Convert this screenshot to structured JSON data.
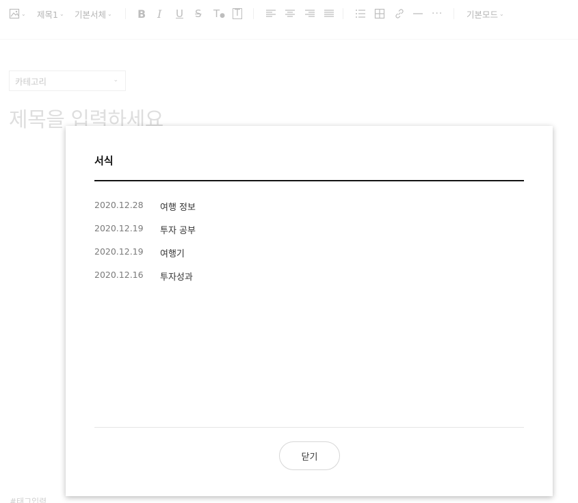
{
  "toolbar": {
    "image_icon": "image-icon",
    "heading_label": "제목1",
    "font_label": "기본서체",
    "bold_glyph": "B",
    "italic_glyph": "I",
    "underline_glyph": "U",
    "strike_glyph": "S",
    "text_color_glyph": "T",
    "text_bg_glyph": "T",
    "align_left_icon": "align-left-icon",
    "align_center_icon": "align-center-icon",
    "align_right_icon": "align-right-icon",
    "align_justify_icon": "align-justify-icon",
    "list_icon": "list-icon",
    "table_icon": "table-icon",
    "link_icon": "link-icon",
    "hr_icon": "horizontal-rule-icon",
    "more_glyph": "···",
    "mode_label": "기본모드"
  },
  "editor": {
    "category_placeholder": "카테고리",
    "title_placeholder": "제목을 입력하세요",
    "tag_placeholder": "#태그입력"
  },
  "modal": {
    "title": "서식",
    "posts": [
      {
        "date": "2020.12.28",
        "title": "여행 정보"
      },
      {
        "date": "2020.12.19",
        "title": "투자 공부"
      },
      {
        "date": "2020.12.19",
        "title": "여행기"
      },
      {
        "date": "2020.12.16",
        "title": "투자성과"
      }
    ],
    "close_label": "닫기"
  }
}
